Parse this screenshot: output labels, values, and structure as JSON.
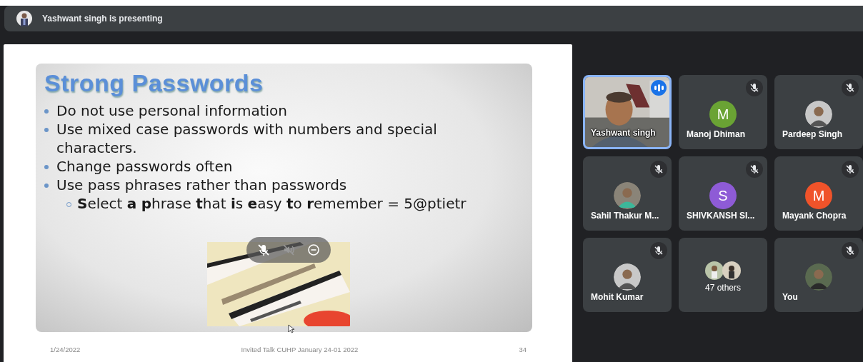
{
  "presenter_bar": {
    "title": "Yashwant singh is presenting"
  },
  "slide": {
    "title": "Strong Passwords",
    "bullets": [
      {
        "text": "Do not use personal information"
      },
      {
        "text": "Use mixed case passwords with numbers and special characters."
      },
      {
        "text": "Change passwords often"
      },
      {
        "text": "Use pass phrases rather than passwords",
        "children": [
          {
            "text": "**S**elect **a** **p**hrase **t**hat **i**s **e**asy **t**o **r**emember = 5@ptietr"
          }
        ]
      }
    ],
    "footer": {
      "date": "1/24/2022",
      "center": "Invited Talk CUHP January 24-01 2022",
      "page": "34"
    }
  },
  "participants": [
    {
      "name": "Yashwant singh",
      "kind": "video",
      "muted": false,
      "speaking": true
    },
    {
      "name": "Manoj Dhiman",
      "kind": "letter",
      "initial": "M",
      "color": "#6aa334",
      "muted": true,
      "speaking": false
    },
    {
      "name": "Pardeep Singh",
      "muted": true,
      "speaking": false
    },
    {
      "name": "Sahil Thakur M...",
      "muted": true,
      "speaking": false
    },
    {
      "name": "SHIVKANSH SI...",
      "kind": "letter",
      "initial": "S",
      "color": "#8e5bd6",
      "muted": true,
      "speaking": false
    },
    {
      "name": "Mayank Chopra",
      "kind": "letter",
      "initial": "M",
      "color": "#f0532a",
      "muted": true,
      "speaking": false
    },
    {
      "name": "Mohit Kumar",
      "muted": true,
      "speaking": false
    },
    {
      "name": "47 others",
      "kind": "others",
      "muted": false,
      "speaking": false
    },
    {
      "name": "You",
      "muted": true,
      "speaking": false
    }
  ]
}
